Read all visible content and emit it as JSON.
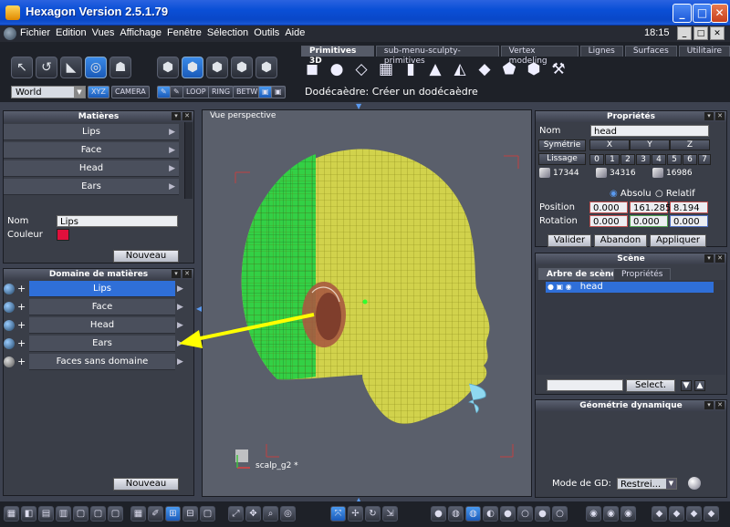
{
  "window": {
    "title": "Hexagon Version 2.5.1.79",
    "controls": [
      "_",
      "□",
      "✕"
    ]
  },
  "menu": {
    "items": [
      "Fichier",
      "Edition",
      "Vues",
      "Affichage",
      "Fenêtre",
      "Sélection",
      "Outils",
      "Aide"
    ],
    "clock": "18:15",
    "controls": [
      "_",
      "□",
      "✕"
    ]
  },
  "toolbar": {
    "world_select": "World",
    "xyz": "XYZ",
    "camera": "CAMERA",
    "loop": "LOOP",
    "ring": "RING",
    "betw": "BETW",
    "tabs": [
      "Primitives 3D",
      "sub-menu-sculpty-primitives",
      "Vertex modeling",
      "Lignes",
      "Surfaces",
      "Utilitaire"
    ],
    "hint": "Dodécaèdre: Créer un dodécaèdre"
  },
  "materials": {
    "header": "Matières",
    "items": [
      "Lips",
      "Face",
      "Head",
      "Ears"
    ],
    "name_label": "Nom",
    "name_value": "Lips",
    "color_label": "Couleur",
    "color_value": "#e0103c",
    "new_button": "Nouveau"
  },
  "domain": {
    "header": "Domaine de matières",
    "items": [
      "Lips",
      "Face",
      "Head",
      "Ears",
      "Faces sans domaine"
    ],
    "new_button": "Nouveau"
  },
  "viewport": {
    "label": "Vue perspective",
    "object_label": "scalp_g2 *"
  },
  "properties": {
    "header": "Propriétés",
    "name_label": "Nom",
    "name_value": "head",
    "symmetry": "Symétrie",
    "axes": [
      "X",
      "Y",
      "Z"
    ],
    "smoothing": "Lissage",
    "levels": [
      "0",
      "1",
      "2",
      "3",
      "4",
      "5",
      "6",
      "7"
    ],
    "counts": [
      "17344",
      "34316",
      "16986"
    ],
    "absolute": "Absolu",
    "relative": "Relatif",
    "position_label": "Position",
    "position": [
      "0.000",
      "161.285",
      "8.194"
    ],
    "rotation_label": "Rotation",
    "rotation": [
      "0.000",
      "0.000",
      "0.000"
    ],
    "validate": "Valider",
    "cancel": "Abandon",
    "apply": "Appliquer"
  },
  "scene": {
    "header": "Scène",
    "tab_tree": "Arbre de scène",
    "tab_props": "Propriétés",
    "item": "head",
    "select_button": "Select."
  },
  "dyn_geometry": {
    "header": "Géométrie dynamique",
    "mode_label": "Mode de GD:",
    "mode_value": "Restrei..."
  }
}
